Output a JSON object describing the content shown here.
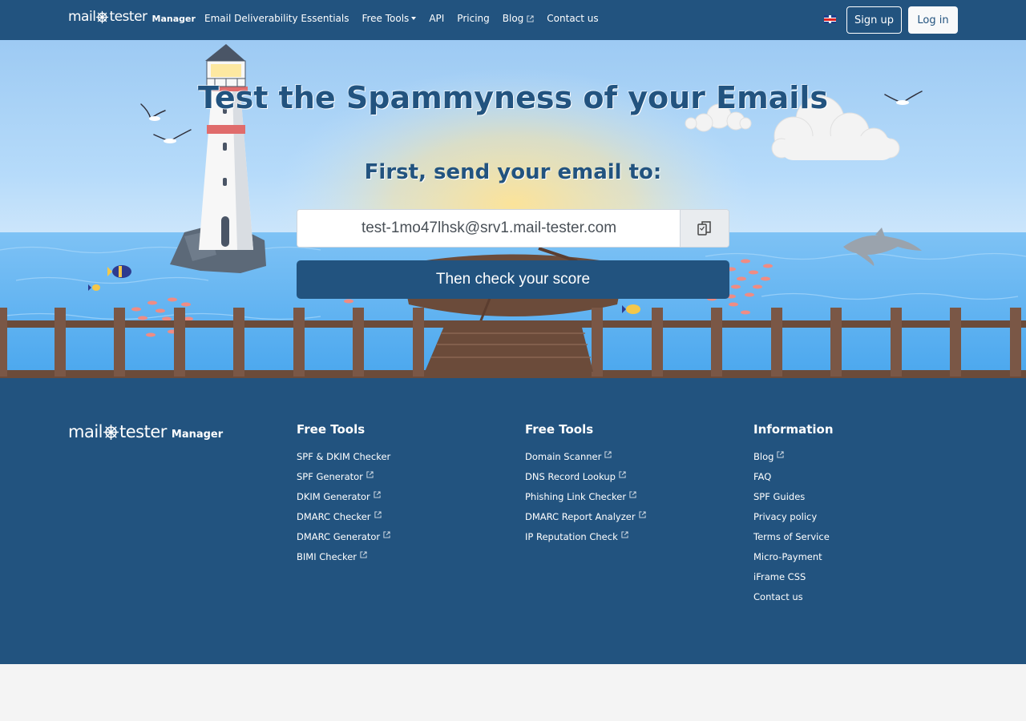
{
  "brand": {
    "word_left": "mail",
    "word_right": "tester",
    "suffix": "Manager"
  },
  "nav": {
    "links": [
      {
        "label": "Email Deliverability Essentials"
      },
      {
        "label": "Free Tools"
      },
      {
        "label": "API"
      },
      {
        "label": "Pricing"
      },
      {
        "label": "Blog"
      },
      {
        "label": "Contact us"
      }
    ],
    "signup": "Sign up",
    "login": "Log in"
  },
  "hero": {
    "title": "Test the Spammyness of your Emails",
    "subtitle": "First, send your email to:",
    "email": "test-1mo47lhsk@srv1.mail-tester.com",
    "check_button": "Then check your score"
  },
  "footer": {
    "columns": [
      {
        "title": "Free Tools",
        "items": [
          "SPF & DKIM Checker",
          "SPF Generator",
          "DKIM Generator",
          "DMARC Checker",
          "DMARC Generator",
          "BIMI Checker"
        ]
      },
      {
        "title": "Free Tools",
        "items": [
          "Domain Scanner",
          "DNS Record Lookup",
          "Phishing Link Checker",
          "DMARC Report Analyzer",
          "IP Reputation Check"
        ]
      },
      {
        "title": "Information",
        "items": [
          "Blog",
          "FAQ",
          "SPF Guides",
          "Privacy policy",
          "Terms of Service",
          "Micro-Payment",
          "iFrame CSS",
          "Contact us"
        ]
      }
    ]
  },
  "colors": {
    "brand_blue": "#22537f",
    "sky": "#b6dbfa",
    "sea": "#62b3f1",
    "wood": "#6b4b3a"
  },
  "icons": {
    "copy": "copy-icon",
    "external": "external-link-icon",
    "dropdown": "caret-down-icon",
    "language": "uk-flag-icon"
  }
}
